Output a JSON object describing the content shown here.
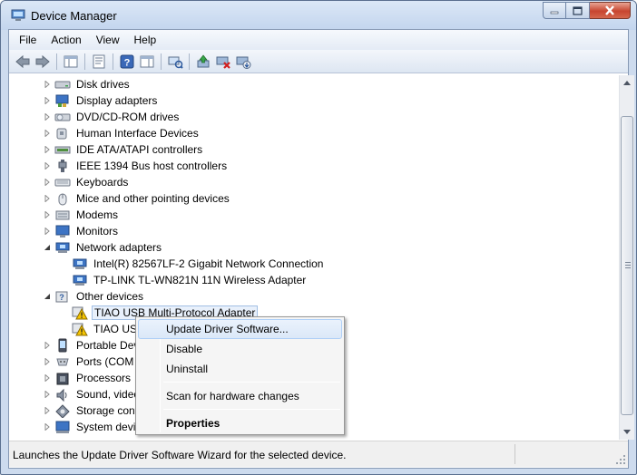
{
  "window": {
    "title": "Device Manager"
  },
  "colors": {
    "accent": "#3399ff",
    "titlebar": "#c3d5ee",
    "close_button": "#c7452f",
    "warning": "#f5c400"
  },
  "menu": [
    "File",
    "Action",
    "View",
    "Help"
  ],
  "toolbar": [
    {
      "name": "back-button",
      "icon": "arrow-left-icon"
    },
    {
      "name": "forward-button",
      "icon": "arrow-right-icon"
    },
    {
      "name": "show-hide-console-tree-button",
      "icon": "console-tree-icon"
    },
    {
      "name": "properties-button",
      "icon": "properties-icon"
    },
    {
      "name": "help-button",
      "icon": "help-icon"
    },
    {
      "name": "show-action-pane-button",
      "icon": "action-pane-icon"
    },
    {
      "name": "scan-hardware-button",
      "icon": "scan-icon"
    },
    {
      "name": "update-driver-button",
      "icon": "update-driver-icon"
    },
    {
      "name": "uninstall-button",
      "icon": "uninstall-icon"
    },
    {
      "name": "enable-button",
      "icon": "enable-device-icon"
    }
  ],
  "tree": [
    {
      "label": "Disk drives",
      "icon": "disk-drive-icon",
      "level": 0,
      "state": "collapsed"
    },
    {
      "label": "Display adapters",
      "icon": "display-adapter-icon",
      "level": 0,
      "state": "collapsed"
    },
    {
      "label": "DVD/CD-ROM drives",
      "icon": "dvd-icon",
      "level": 0,
      "state": "collapsed"
    },
    {
      "label": "Human Interface Devices",
      "icon": "hid-icon",
      "level": 0,
      "state": "collapsed"
    },
    {
      "label": "IDE ATA/ATAPI controllers",
      "icon": "ide-controller-icon",
      "level": 0,
      "state": "collapsed"
    },
    {
      "label": "IEEE 1394 Bus host controllers",
      "icon": "firewire-icon",
      "level": 0,
      "state": "collapsed"
    },
    {
      "label": "Keyboards",
      "icon": "keyboard-icon",
      "level": 0,
      "state": "collapsed"
    },
    {
      "label": "Mice and other pointing devices",
      "icon": "mouse-icon",
      "level": 0,
      "state": "collapsed"
    },
    {
      "label": "Modems",
      "icon": "modem-icon",
      "level": 0,
      "state": "collapsed"
    },
    {
      "label": "Monitors",
      "icon": "monitor-icon",
      "level": 0,
      "state": "collapsed"
    },
    {
      "label": "Network adapters",
      "icon": "network-adapter-icon",
      "level": 0,
      "state": "expanded"
    },
    {
      "label": "Intel(R) 82567LF-2 Gigabit Network Connection",
      "icon": "network-adapter-icon",
      "level": 1,
      "state": "leaf"
    },
    {
      "label": "TP-LINK TL-WN821N 11N Wireless Adapter",
      "icon": "network-adapter-icon",
      "level": 1,
      "state": "leaf"
    },
    {
      "label": "Other devices",
      "icon": "unknown-device-icon",
      "level": 0,
      "state": "expanded"
    },
    {
      "label": "TIAO USB Multi-Protocol Adapter",
      "icon": "warning-device-icon",
      "level": 1,
      "state": "leaf",
      "selected": true
    },
    {
      "label": "TIAO USB",
      "icon": "warning-device-icon",
      "level": 1,
      "state": "leaf"
    },
    {
      "label": "Portable Devic",
      "icon": "portable-device-icon",
      "level": 0,
      "state": "collapsed"
    },
    {
      "label": "Ports (COM &",
      "icon": "port-icon",
      "level": 0,
      "state": "collapsed"
    },
    {
      "label": "Processors",
      "icon": "processor-icon",
      "level": 0,
      "state": "collapsed"
    },
    {
      "label": "Sound, video",
      "icon": "sound-icon",
      "level": 0,
      "state": "collapsed"
    },
    {
      "label": "Storage contr",
      "icon": "storage-controller-icon",
      "level": 0,
      "state": "collapsed"
    },
    {
      "label": "System device",
      "icon": "system-device-icon",
      "level": 0,
      "state": "collapsed"
    }
  ],
  "context_menu": {
    "items": [
      {
        "label": "Update Driver Software...",
        "highlighted": true,
        "bold": false
      },
      {
        "label": "Disable",
        "highlighted": false,
        "bold": false
      },
      {
        "label": "Uninstall",
        "highlighted": false,
        "bold": false
      },
      {
        "separator": true
      },
      {
        "label": "Scan for hardware changes",
        "highlighted": false,
        "bold": false
      },
      {
        "separator": true
      },
      {
        "label": "Properties",
        "highlighted": false,
        "bold": true
      }
    ]
  },
  "status": {
    "text": "Launches the Update Driver Software Wizard for the selected device."
  }
}
